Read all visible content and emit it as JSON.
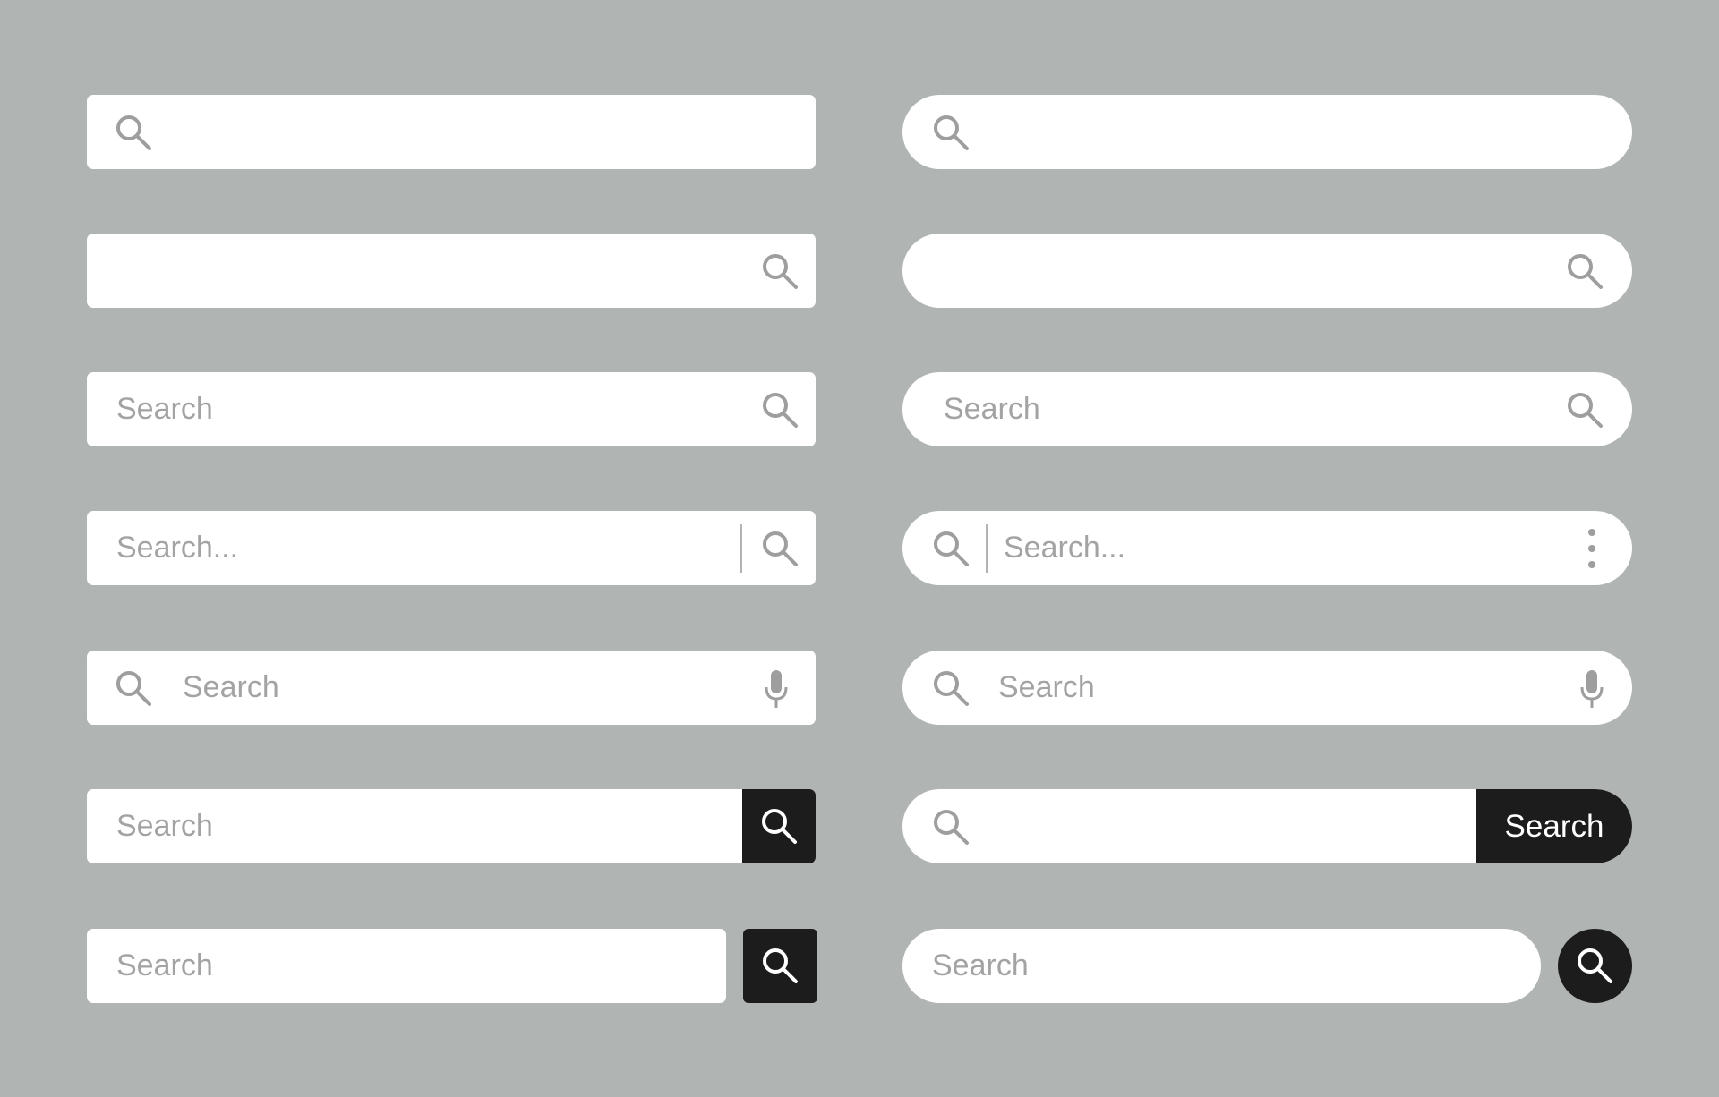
{
  "colors": {
    "background": "#b0b5b3",
    "field": "#ffffff",
    "icon": "#9e9e9e",
    "placeholder": "#a3a3a3",
    "button": "#1c1c1c",
    "button_text": "#ffffff"
  },
  "icons": {
    "search": "magnifier-icon",
    "voice": "microphone-icon",
    "more": "kebab-vertical-icon"
  },
  "bars": {
    "r3_left_placeholder": "Search",
    "r3_right_placeholder": "Search",
    "r4_left_placeholder": "Search...",
    "r4_right_placeholder": "Search...",
    "r5_left_placeholder": "Search",
    "r5_right_placeholder": "Search",
    "r6_left_placeholder": "Search",
    "r6_right_button_label": "Search",
    "r7_left_placeholder": "Search",
    "r7_right_placeholder": "Search"
  }
}
